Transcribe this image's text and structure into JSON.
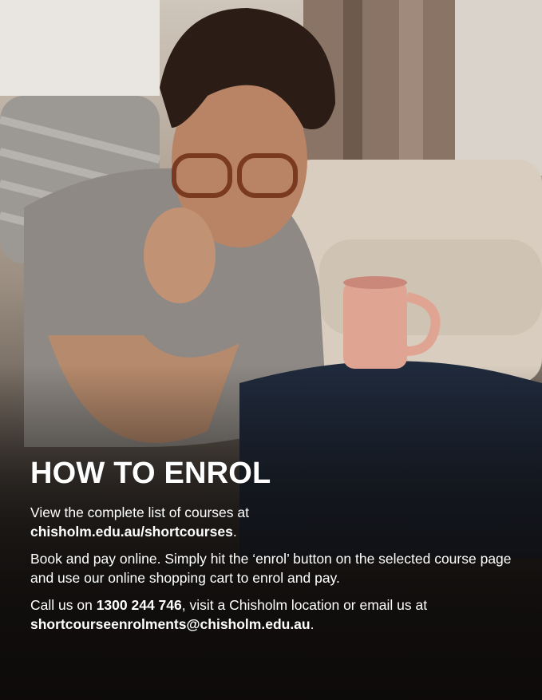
{
  "section": {
    "heading": "HOW TO ENROL"
  },
  "paragraphs": [
    {
      "intro": "View the complete list of courses at",
      "link": "chisholm.edu.au/shortcourses",
      "end": "."
    },
    {
      "text": "Book and pay online. Simply hit the ‘enrol’ button on the selected course page and use our online shopping cart to enrol and pay."
    },
    {
      "pre_phone": "Call us on",
      "phone": "1300 244 746",
      "mid": ", visit a Chisholm location or email us at",
      "email": "shortcourseenrolments@chisholm.edu.au",
      "end": "."
    }
  ]
}
